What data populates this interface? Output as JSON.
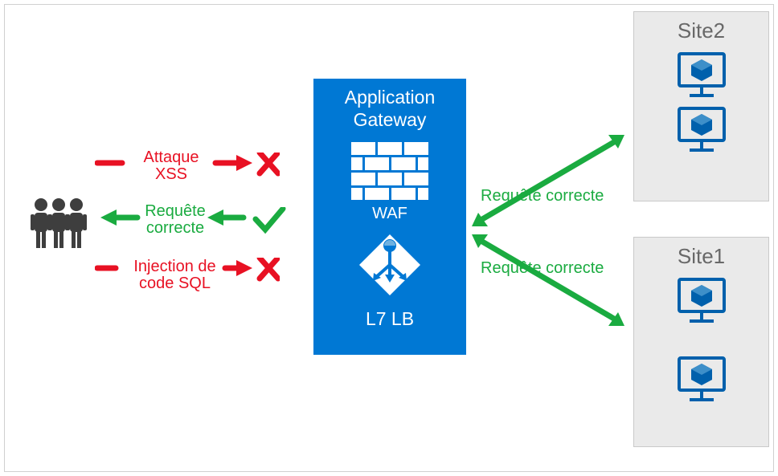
{
  "gateway": {
    "title_line1": "Application",
    "title_line2": "Gateway",
    "waf_label": "WAF",
    "l7_label": "L7 LB"
  },
  "left_flows": {
    "xss": {
      "line1": "Attaque",
      "line2": "XSS"
    },
    "valid": {
      "line1": "Requête",
      "line2": "correcte"
    },
    "sql": {
      "line1": "Injection de",
      "line2": "code SQL"
    }
  },
  "right_flows": {
    "top": "Requête correcte",
    "bottom": "Requête correcte"
  },
  "sites": {
    "site1_title": "Site1",
    "site2_title": "Site2"
  },
  "colors": {
    "accent_blue": "#0078d4",
    "vm_blue": "#0060ac",
    "red": "#e81123",
    "green": "#1aab40",
    "grey_box": "#eaeaea",
    "people_grey": "#3e3e3e"
  }
}
